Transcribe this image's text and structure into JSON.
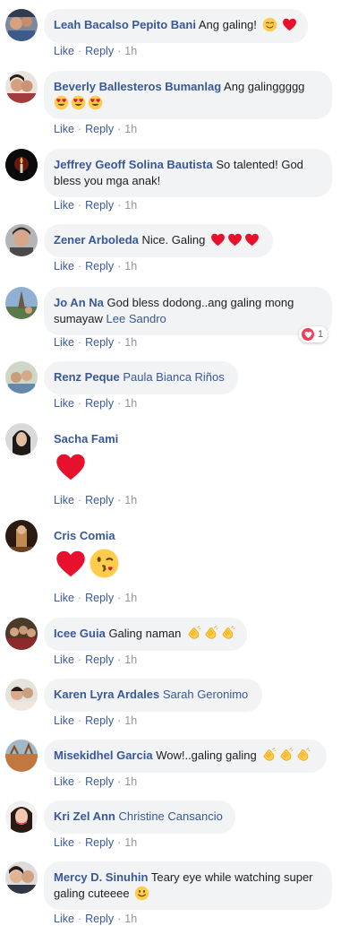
{
  "labels": {
    "like": "Like",
    "reply": "Reply",
    "sep": "·",
    "time": "1h"
  },
  "comments": [
    {
      "name": "Leah Bacalso Pepito Bani",
      "text": "Ang galing!"
    },
    {
      "name": "Beverly Ballesteros Bumanlag",
      "text": "Ang galinggggg"
    },
    {
      "name": "Jeffrey Geoff Solina Bautista",
      "text": "So talented! God bless you mga anak!"
    },
    {
      "name": "Zener Arboleda",
      "text": "Nice. Galing"
    },
    {
      "name": "Jo An Na",
      "text": "God bless dodong..ang galing mong sumayaw",
      "tag": "Lee Sandro",
      "reaction_count": "1"
    },
    {
      "name": "Renz Peque",
      "tag": "Paula Bianca Riños"
    },
    {
      "name": "Sacha Fami"
    },
    {
      "name": "Cris Comia"
    },
    {
      "name": "Icee Guia",
      "text": "Galing naman"
    },
    {
      "name": "Karen Lyra Ardales",
      "tag": "Sarah Geronimo"
    },
    {
      "name": "Misekidhel Garcia",
      "text": "Wow!..galing galing"
    },
    {
      "name": "Kri Zel Ann",
      "tag": "Christine Cansancio"
    },
    {
      "name": "Mercy D. Sinuhin",
      "text": "Teary eye while watching super galing cuteeee"
    }
  ]
}
